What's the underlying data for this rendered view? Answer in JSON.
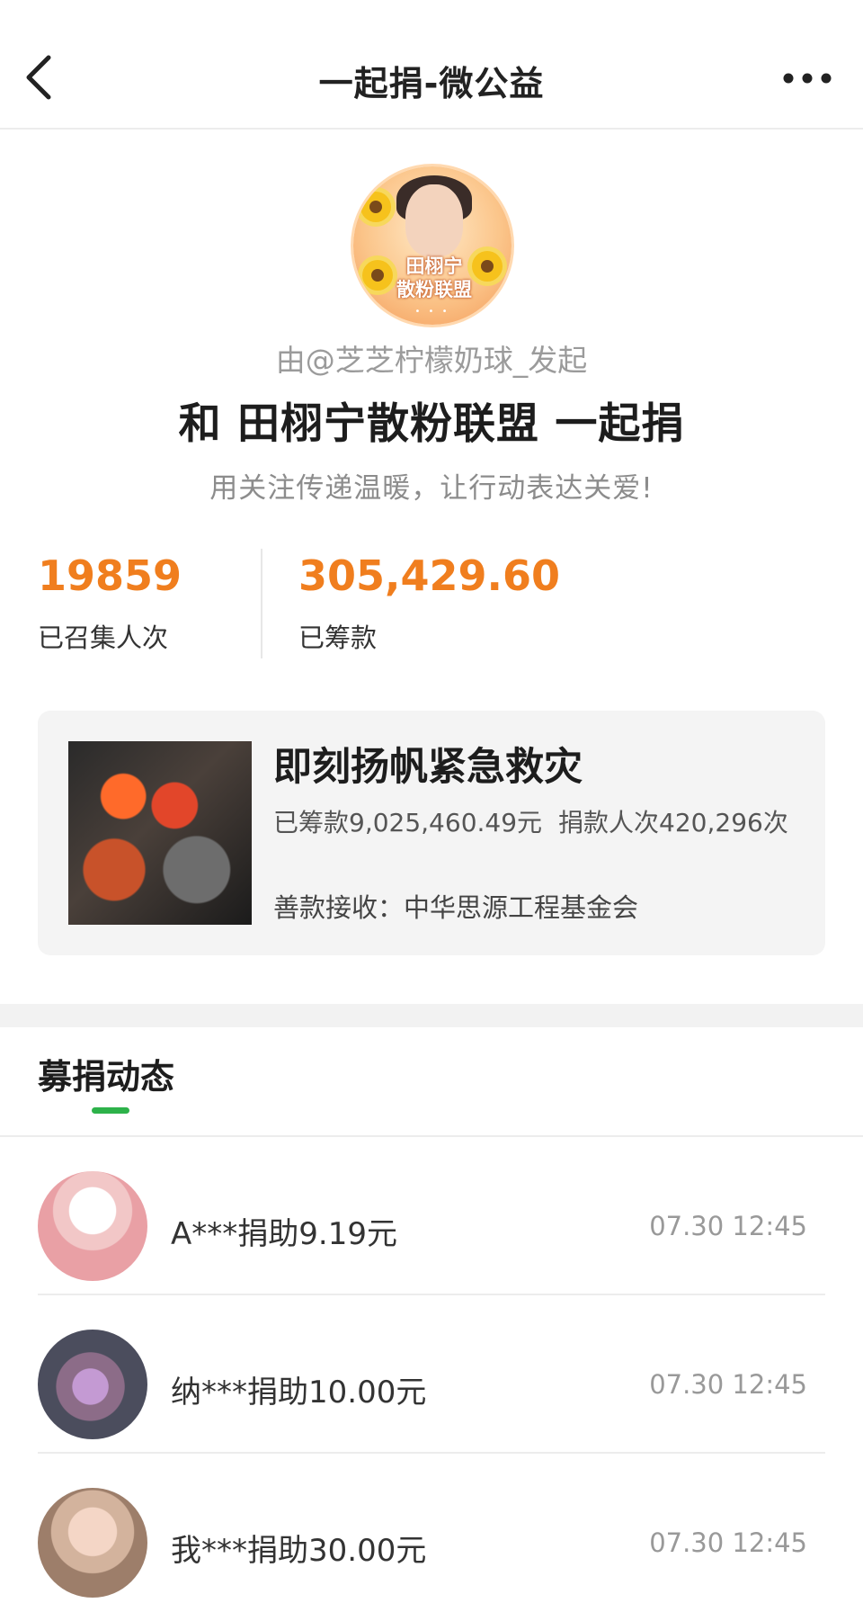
{
  "nav": {
    "title": "一起捐-微公益",
    "back_icon": "chevron-left-icon",
    "more_icon": "more-dots-icon"
  },
  "header": {
    "avatar_tag_line1": "田栩宁",
    "avatar_tag_line2": "散粉联盟",
    "avatar_dots": "• • •",
    "initiator": "由@芝芝柠檬奶球_发起",
    "title": "和 田栩宁散粉联盟 一起捐",
    "slogan": "用关注传递温暖，让行动表达关爱!"
  },
  "stats": {
    "people_count": "19859",
    "people_label": "已召集人次",
    "amount": "305,429.60",
    "amount_label": "已筹款"
  },
  "project": {
    "title": "即刻扬帆紧急救灾",
    "raised": "已筹款9,025,460.49元",
    "donors": "捐款人次420,296次",
    "receiver": "善款接收：中华思源工程基金会"
  },
  "section": {
    "tab_label": "募捐动态"
  },
  "feed": [
    {
      "text": "A***捐助9.19元",
      "time": "07.30 12:45"
    },
    {
      "text": "纳***捐助10.00元",
      "time": "07.30 12:45"
    },
    {
      "text": "我***捐助30.00元",
      "time": "07.30 12:45"
    }
  ],
  "colors": {
    "accent_orange": "#f07e1e",
    "indicator_green": "#2db24a"
  }
}
